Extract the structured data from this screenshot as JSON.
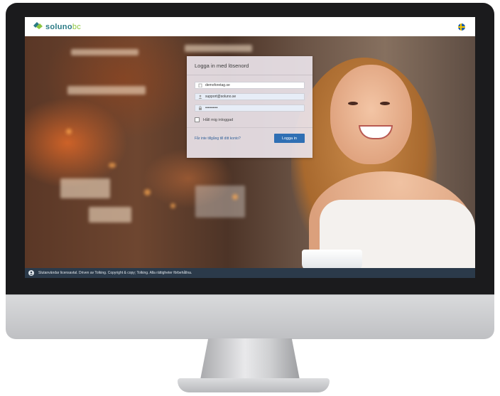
{
  "header": {
    "logo_text_bold": "soluno",
    "logo_text_thin": "bc",
    "language_flag": "sweden-flag-icon"
  },
  "login": {
    "title": "Logga in med lösenord",
    "company_field": {
      "value": "demoforetag.se",
      "icon": "building-icon"
    },
    "username_field": {
      "value": "support@soluno.se",
      "icon": "user-icon"
    },
    "password_field": {
      "value": "••••••••••",
      "icon": "lock-icon"
    },
    "remember_label": "Håll mig inloggad",
    "forgot_link": "Får inte tillgång till ditt konto?",
    "submit_label": "Logga in"
  },
  "footer": {
    "text": "Slutanvändar licensavtal. Driven av Tolking. Copyright & copy; Tolking. Alla rättigheter förbehållna.",
    "icon": "user-circle-icon"
  },
  "colors": {
    "brand_teal": "#2a7a85",
    "brand_green": "#8dc63f",
    "button_blue": "#2f6fb4",
    "footer_bg": "#2b3a4a"
  }
}
